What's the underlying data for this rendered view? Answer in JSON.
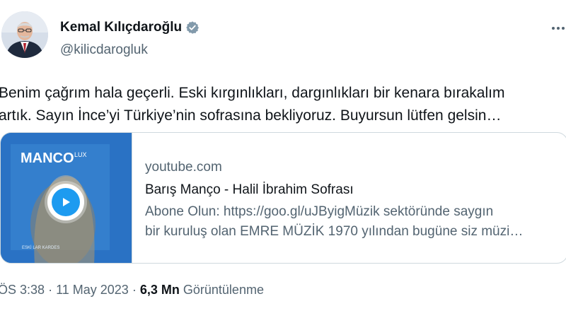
{
  "author": {
    "name": "Kemal Kılıçdaroğlu",
    "handle": "@kilicdarogluk",
    "verified_color": "#829aab"
  },
  "tweet": {
    "text_line1": "Benim çağrım hala geçerli. Eski kırgınlıkları, dargınlıkları bir kenara bırakalım",
    "text_line2": "artık. Sayın İnce’yi Türkiye’nin sofrasına bekliyoruz. Buyursun lütfen gelsin…"
  },
  "card": {
    "thumbnail_title": "MANCO",
    "thumbnail_subtitle": "LUX",
    "thumbnail_caption": "ESKİ LAR KARDES",
    "domain": "youtube.com",
    "title": "Barış Manço - Halil İbrahim Sofrası",
    "desc_line1": "Abone Olun: https://goo.gl/uJByigMüzik sektöründe saygın",
    "desc_line2": "bir kuruluş olan EMRE MÜZİK 1970 yılından bugüne siz müzi…",
    "play_icon": "play-icon",
    "accent_color": "#1d9bf0"
  },
  "meta": {
    "time": "ÖS 3:38",
    "separator": "·",
    "date": "11 May 2023",
    "views_count": "6,3 Mn",
    "views_label": "Görüntülenme"
  }
}
